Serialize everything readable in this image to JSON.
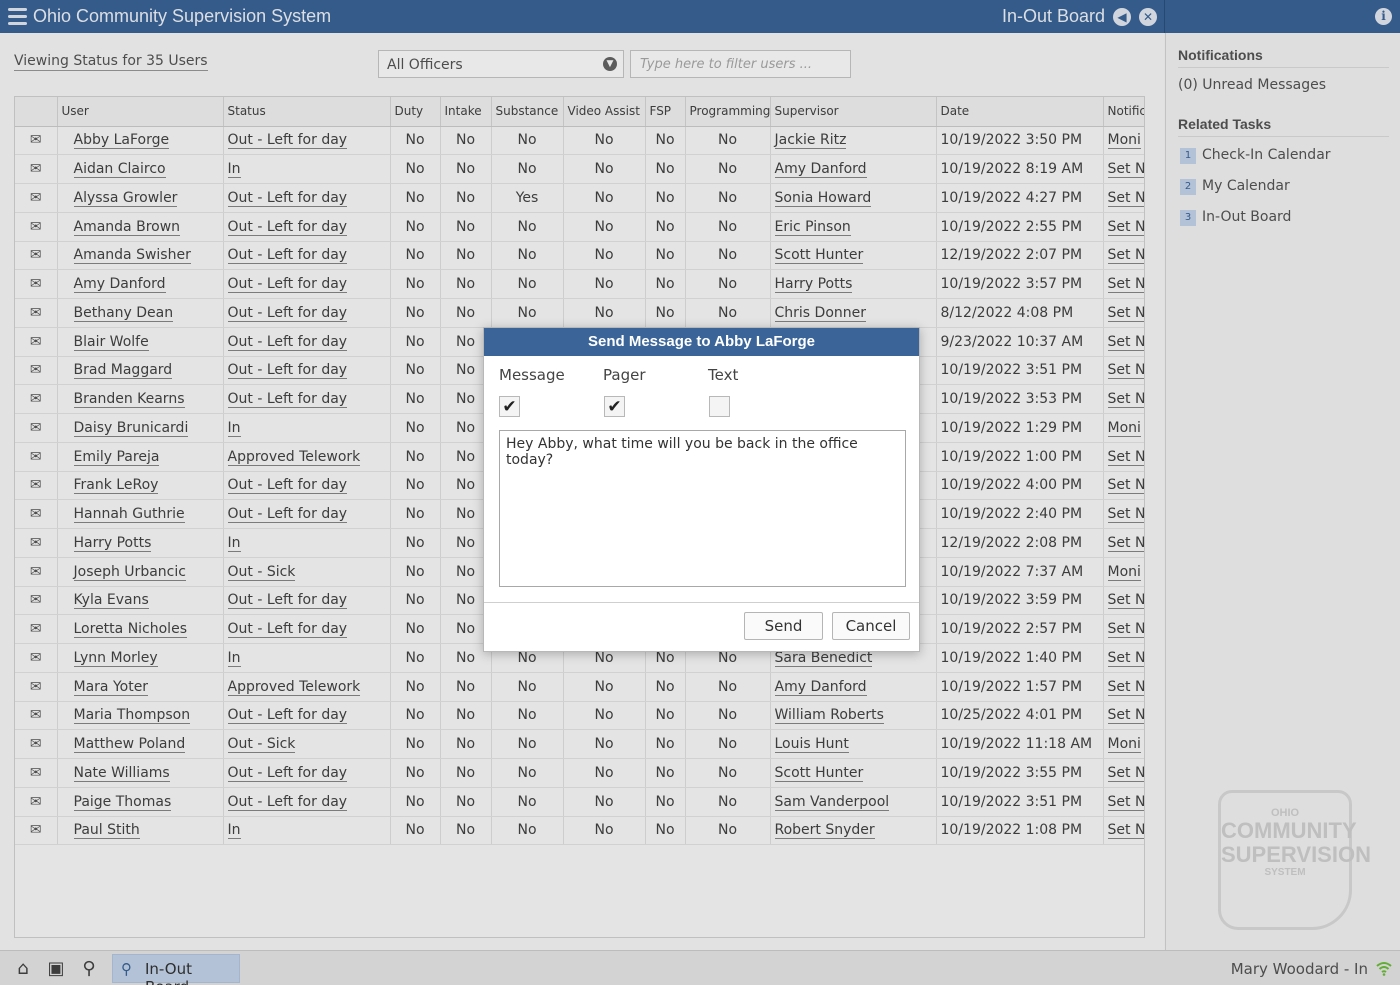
{
  "titlebar": {
    "app_title": "Ohio Community Supervision System",
    "board_title": "In-Out Board"
  },
  "toolbar": {
    "viewing_status": "Viewing Status for 35 Users",
    "officer_select": "All Officers",
    "filter_placeholder": "Type here to filter users ..."
  },
  "table": {
    "columns": [
      "",
      "User",
      "Status",
      "Duty",
      "Intake",
      "Substance",
      "Video Assist",
      "FSP",
      "Programming",
      "Supervisor",
      "Date",
      "Notific"
    ],
    "rows": [
      {
        "user": "Abby LaForge",
        "status": "Out - Left for day",
        "duty": "No",
        "intake": "No",
        "substance": "No",
        "video": "No",
        "fsp": "No",
        "prog": "No",
        "supervisor": "Jackie Ritz",
        "date": "10/19/2022 3:50 PM",
        "notif": "Moni"
      },
      {
        "user": "Aidan Clairco",
        "status": "In",
        "duty": "No",
        "intake": "No",
        "substance": "No",
        "video": "No",
        "fsp": "No",
        "prog": "No",
        "supervisor": "Amy Danford",
        "date": "10/19/2022 8:19 AM",
        "notif": "Set N"
      },
      {
        "user": "Alyssa Growler",
        "status": "Out - Left for day",
        "duty": "No",
        "intake": "No",
        "substance": "Yes",
        "video": "No",
        "fsp": "No",
        "prog": "No",
        "supervisor": "Sonia Howard",
        "date": "10/19/2022 4:27 PM",
        "notif": "Set N"
      },
      {
        "user": "Amanda Brown",
        "status": "Out - Left for day",
        "duty": "No",
        "intake": "No",
        "substance": "No",
        "video": "No",
        "fsp": "No",
        "prog": "No",
        "supervisor": "Eric Pinson",
        "date": "10/19/2022 2:55 PM",
        "notif": "Set N"
      },
      {
        "user": "Amanda Swisher",
        "status": "Out - Left for day",
        "duty": "No",
        "intake": "No",
        "substance": "No",
        "video": "No",
        "fsp": "No",
        "prog": "No",
        "supervisor": "Scott Hunter",
        "date": "12/19/2022 2:07 PM",
        "notif": "Set N"
      },
      {
        "user": "Amy Danford",
        "status": "Out - Left for day",
        "duty": "No",
        "intake": "No",
        "substance": "No",
        "video": "No",
        "fsp": "No",
        "prog": "No",
        "supervisor": "Harry Potts",
        "date": "10/19/2022 3:57 PM",
        "notif": "Set N"
      },
      {
        "user": "Bethany Dean",
        "status": "Out - Left for day",
        "duty": "No",
        "intake": "No",
        "substance": "No",
        "video": "No",
        "fsp": "No",
        "prog": "No",
        "supervisor": "Chris Donner",
        "date": "8/12/2022 4:08 PM",
        "notif": "Set N"
      },
      {
        "user": "Blair Wolfe",
        "status": "Out - Left for day",
        "duty": "No",
        "intake": "No",
        "substance": "",
        "video": "",
        "fsp": "",
        "prog": "",
        "supervisor": "",
        "date": "9/23/2022 10:37 AM",
        "notif": "Set N"
      },
      {
        "user": "Brad Maggard",
        "status": "Out - Left for day",
        "duty": "No",
        "intake": "No",
        "substance": "",
        "video": "",
        "fsp": "",
        "prog": "",
        "supervisor": "",
        "date": "10/19/2022 3:51 PM",
        "notif": "Set N"
      },
      {
        "user": "Branden Kearns",
        "status": "Out - Left for day",
        "duty": "No",
        "intake": "No",
        "substance": "",
        "video": "",
        "fsp": "",
        "prog": "",
        "supervisor": "",
        "date": "10/19/2022 3:53 PM",
        "notif": "Set N"
      },
      {
        "user": "Daisy Brunicardi",
        "status": "In",
        "duty": "No",
        "intake": "No",
        "substance": "",
        "video": "",
        "fsp": "",
        "prog": "",
        "supervisor": "",
        "date": "10/19/2022 1:29 PM",
        "notif": "Moni"
      },
      {
        "user": "Emily Pareja",
        "status": "Approved Telework",
        "duty": "No",
        "intake": "No",
        "substance": "",
        "video": "",
        "fsp": "",
        "prog": "",
        "supervisor": "",
        "date": "10/19/2022 1:00 PM",
        "notif": "Set N"
      },
      {
        "user": "Frank LeRoy",
        "status": "Out - Left for day",
        "duty": "No",
        "intake": "No",
        "substance": "",
        "video": "",
        "fsp": "",
        "prog": "",
        "supervisor": "",
        "date": "10/19/2022 4:00 PM",
        "notif": "Set N"
      },
      {
        "user": "Hannah Guthrie",
        "status": "Out - Left for day",
        "duty": "No",
        "intake": "No",
        "substance": "",
        "video": "",
        "fsp": "",
        "prog": "",
        "supervisor": "",
        "date": "10/19/2022 2:40 PM",
        "notif": "Set N"
      },
      {
        "user": "Harry Potts",
        "status": "In",
        "duty": "No",
        "intake": "No",
        "substance": "",
        "video": "",
        "fsp": "",
        "prog": "",
        "supervisor": "",
        "date": "12/19/2022 2:08 PM",
        "notif": "Set N"
      },
      {
        "user": "Joseph Urbancic",
        "status": "Out - Sick",
        "duty": "No",
        "intake": "No",
        "substance": "",
        "video": "",
        "fsp": "",
        "prog": "",
        "supervisor": "",
        "date": "10/19/2022 7:37 AM",
        "notif": "Moni"
      },
      {
        "user": "Kyla Evans",
        "status": "Out - Left for day",
        "duty": "No",
        "intake": "No",
        "substance": "",
        "video": "",
        "fsp": "",
        "prog": "",
        "supervisor": "",
        "date": "10/19/2022 3:59 PM",
        "notif": "Set N"
      },
      {
        "user": "Loretta Nicholes",
        "status": "Out - Left for day",
        "duty": "No",
        "intake": "No",
        "substance": "",
        "video": "",
        "fsp": "",
        "prog": "",
        "supervisor": "",
        "date": "10/19/2022 2:57 PM",
        "notif": "Set N"
      },
      {
        "user": "Lynn Morley",
        "status": "In",
        "duty": "No",
        "intake": "No",
        "substance": "No",
        "video": "No",
        "fsp": "No",
        "prog": "No",
        "supervisor": "Sara Benedict",
        "date": "10/19/2022 1:40 PM",
        "notif": "Set N"
      },
      {
        "user": "Mara Yoter",
        "status": "Approved Telework",
        "duty": "No",
        "intake": "No",
        "substance": "No",
        "video": "No",
        "fsp": "No",
        "prog": "No",
        "supervisor": "Amy Danford",
        "date": "10/19/2022 1:57 PM",
        "notif": "Set N"
      },
      {
        "user": "Maria Thompson",
        "status": "Out - Left for day",
        "duty": "No",
        "intake": "No",
        "substance": "No",
        "video": "No",
        "fsp": "No",
        "prog": "No",
        "supervisor": "William Roberts",
        "date": "10/25/2022 4:01 PM",
        "notif": "Set N"
      },
      {
        "user": "Matthew Poland",
        "status": "Out - Sick",
        "duty": "No",
        "intake": "No",
        "substance": "No",
        "video": "No",
        "fsp": "No",
        "prog": "No",
        "supervisor": "Louis Hunt",
        "date": "10/19/2022 11:18 AM",
        "notif": "Moni"
      },
      {
        "user": "Nate Williams",
        "status": "Out - Left for day",
        "duty": "No",
        "intake": "No",
        "substance": "No",
        "video": "No",
        "fsp": "No",
        "prog": "No",
        "supervisor": "Scott Hunter",
        "date": "10/19/2022 3:55 PM",
        "notif": "Set N"
      },
      {
        "user": "Paige Thomas",
        "status": "Out - Left for day",
        "duty": "No",
        "intake": "No",
        "substance": "No",
        "video": "No",
        "fsp": "No",
        "prog": "No",
        "supervisor": "Sam Vanderpool",
        "date": "10/19/2022 3:51 PM",
        "notif": "Set N"
      },
      {
        "user": "Paul Stith",
        "status": "In",
        "duty": "No",
        "intake": "No",
        "substance": "No",
        "video": "No",
        "fsp": "No",
        "prog": "No",
        "supervisor": "Robert Snyder",
        "date": "10/19/2022 1:08 PM",
        "notif": "Set N"
      }
    ]
  },
  "sidebar": {
    "notifications_heading": "Notifications",
    "unread": "(0) Unread Messages",
    "related_heading": "Related Tasks",
    "tasks": [
      {
        "num": "1",
        "label": "Check-In Calendar"
      },
      {
        "num": "2",
        "label": "My Calendar"
      },
      {
        "num": "3",
        "label": "In-Out Board"
      }
    ],
    "watermark": {
      "line1": "OHIO",
      "line2": "COMMUNITY",
      "line3": "SUPERVISION",
      "line4": "SYSTEM"
    }
  },
  "statusbar": {
    "active_tab": "In-Out Board",
    "user_status": "Mary Woodard - In"
  },
  "dialog": {
    "title": "Send Message to Abby LaForge",
    "options": [
      {
        "label": "Message",
        "checked": true
      },
      {
        "label": "Pager",
        "checked": true
      },
      {
        "label": "Text",
        "checked": false
      }
    ],
    "message": "Hey Abby, what time will you be back in the office today?",
    "send_label": "Send",
    "cancel_label": "Cancel"
  },
  "colors": {
    "brand": "#3b6599",
    "tab_highlight": "#c5d6ec"
  }
}
